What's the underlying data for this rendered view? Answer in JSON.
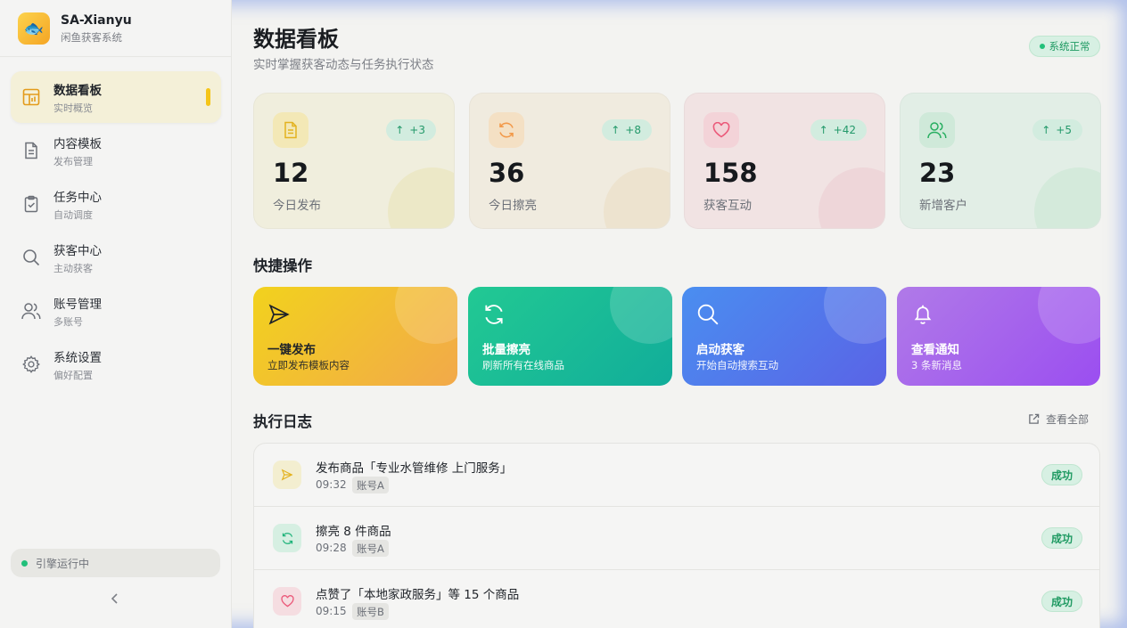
{
  "app": {
    "name": "SA-Xianyu",
    "subtitle": "闲鱼获客系统"
  },
  "sidebar": {
    "items": [
      {
        "label": "数据看板",
        "sub": "实时概览",
        "icon": "dashboard-icon",
        "active": true
      },
      {
        "label": "内容模板",
        "sub": "发布管理",
        "icon": "document-icon"
      },
      {
        "label": "任务中心",
        "sub": "自动调度",
        "icon": "clipboard-check-icon"
      },
      {
        "label": "获客中心",
        "sub": "主动获客",
        "icon": "search-icon"
      },
      {
        "label": "账号管理",
        "sub": "多账号",
        "icon": "users-icon"
      },
      {
        "label": "系统设置",
        "sub": "偏好配置",
        "icon": "gear-icon"
      }
    ],
    "engine_status": "引擎运行中"
  },
  "header": {
    "title": "数据看板",
    "subtitle": "实时掌握获客动态与任务执行状态",
    "system_status": "系统正常"
  },
  "stats": [
    {
      "value": "12",
      "label": "今日发布",
      "delta": "+3",
      "icon": "document-icon",
      "color": "#f2c94c"
    },
    {
      "value": "36",
      "label": "今日擦亮",
      "delta": "+8",
      "icon": "refresh-icon",
      "color": "#f2994a"
    },
    {
      "value": "158",
      "label": "获客互动",
      "delta": "+42",
      "icon": "heart-icon",
      "color": "#eb5a7a"
    },
    {
      "value": "23",
      "label": "新增客户",
      "delta": "+5",
      "icon": "users-icon",
      "color": "#27ae60"
    }
  ],
  "quick_actions": {
    "title": "快捷操作",
    "items": [
      {
        "title": "一键发布",
        "sub": "立即发布模板内容",
        "icon": "send-icon"
      },
      {
        "title": "批量擦亮",
        "sub": "刷新所有在线商品",
        "icon": "refresh-icon"
      },
      {
        "title": "启动获客",
        "sub": "开始自动搜索互动",
        "icon": "search-icon"
      },
      {
        "title": "查看通知",
        "sub": "3 条新消息",
        "icon": "bell-icon"
      }
    ]
  },
  "logs": {
    "title": "执行日志",
    "view_all": "查看全部",
    "items": [
      {
        "text": "发布商品「专业水管维修 上门服务」",
        "time": "09:32",
        "account": "账号A",
        "status": "成功",
        "icon": "send-icon"
      },
      {
        "text": "擦亮 8 件商品",
        "time": "09:28",
        "account": "账号A",
        "status": "成功",
        "icon": "refresh-icon"
      },
      {
        "text": "点赞了「本地家政服务」等 15 个商品",
        "time": "09:15",
        "account": "账号B",
        "status": "成功",
        "icon": "heart-icon"
      }
    ]
  },
  "colors": {
    "accent_yellow": "#f5c518",
    "success_green": "#22c07a",
    "action_publish": "#f0c419",
    "action_polish": "#1fbf8f",
    "action_acquire": "#4f7fe8",
    "action_notify": "#a066ee"
  }
}
